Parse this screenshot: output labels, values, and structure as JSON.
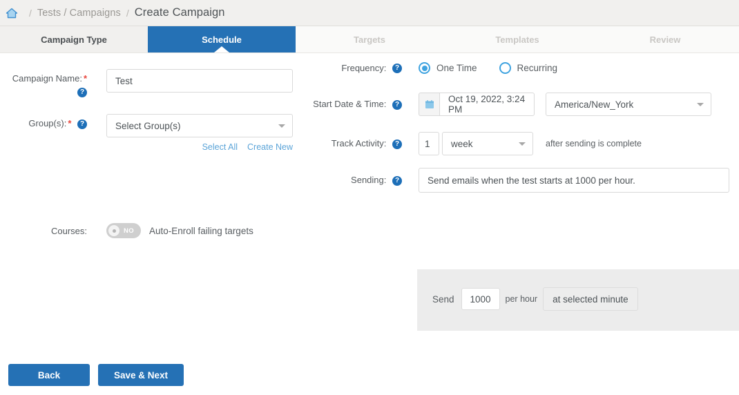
{
  "breadcrumb": {
    "home_icon": "home-icon",
    "separator": "/",
    "parent": "Tests / Campaigns",
    "current": "Create Campaign"
  },
  "wizard": {
    "tabs": [
      {
        "label": "Campaign Type",
        "state": "done"
      },
      {
        "label": "Schedule",
        "state": "active"
      },
      {
        "label": "Targets",
        "state": "future"
      },
      {
        "label": "Templates",
        "state": "future"
      },
      {
        "label": "Review",
        "state": "future"
      }
    ]
  },
  "form": {
    "help_glyph": "?",
    "required_glyph": "*",
    "campaign_name": {
      "label": "Campaign Name:",
      "value": "Test",
      "placeholder": ""
    },
    "groups": {
      "label": "Group(s):",
      "value": "Select Group(s)",
      "select_all": "Select All",
      "create_new": "Create New"
    },
    "courses": {
      "label": "Courses:",
      "toggle_state": "NO",
      "toggle_caption": "Auto-Enroll failing targets"
    },
    "frequency": {
      "label": "Frequency:",
      "options": [
        {
          "label": "One Time",
          "selected": true
        },
        {
          "label": "Recurring",
          "selected": false
        }
      ]
    },
    "start_datetime": {
      "label": "Start Date & Time:",
      "calendar_icon": "calendar-icon",
      "value": "Oct 19, 2022, 3:24 PM",
      "timezone": "America/New_York"
    },
    "track_activity": {
      "label": "Track Activity:",
      "amount": "1",
      "unit": "week",
      "suffix": "after sending is complete"
    },
    "sending": {
      "label": "Sending:",
      "summary": "Send emails when the test starts at 1000 per hour.",
      "panel": {
        "send_label": "Send",
        "rate": "1000",
        "per_hour_label": "per hour",
        "minute_button": "at selected minute"
      }
    }
  },
  "footer": {
    "back": "Back",
    "save_next": "Save & Next"
  },
  "colors": {
    "accent_blue": "#2571b5",
    "light_blue": "#3fa3e0",
    "link_blue": "#5ba4d8",
    "required_red": "#e8453c",
    "tab_done_bg": "#f1f0ee",
    "tab_future_bg": "#fafaf9",
    "panel_gray": "#ececec"
  }
}
